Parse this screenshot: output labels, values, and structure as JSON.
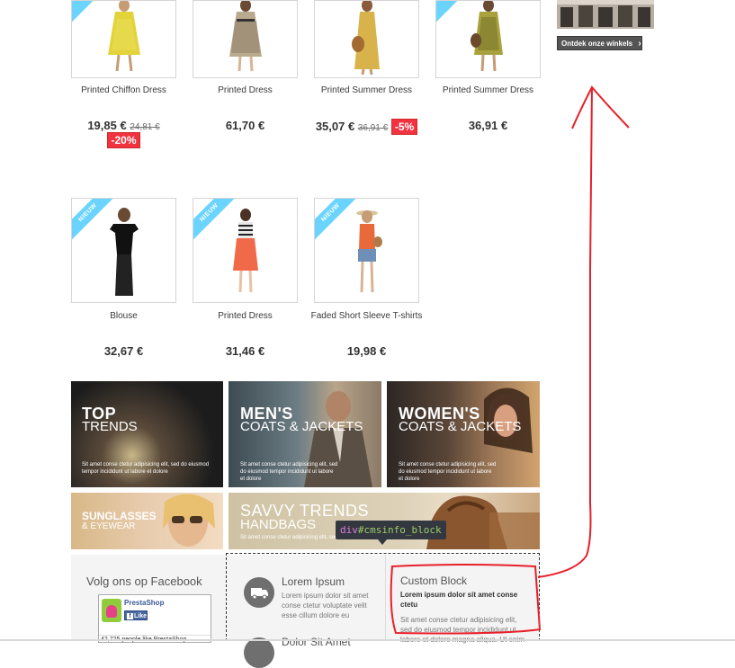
{
  "store": {
    "button_label": "Ontdek onze winkels",
    "chevron_glyph": "›"
  },
  "products_row1": [
    {
      "name": "Printed Chiffon Dress",
      "price": "19,85 €",
      "old_price": "24,81 €",
      "discount": "-20%"
    },
    {
      "name": "Printed Dress",
      "price": "61,70 €"
    },
    {
      "name": "Printed Summer Dress",
      "price": "35,07 €",
      "old_price": "36,91 €",
      "discount": "-5%"
    },
    {
      "name": "Printed Summer Dress",
      "price": "36,91 €"
    }
  ],
  "products_row2": [
    {
      "name": "Blouse",
      "price": "32,67 €",
      "badge": "NIEUW"
    },
    {
      "name": "Printed Dress",
      "price": "31,46 €",
      "badge": "NIEUW"
    },
    {
      "name": "Faded Short Sleeve T-shirts",
      "price": "19,98 €",
      "badge": "NIEUW"
    }
  ],
  "banners": {
    "top": {
      "line1": "TOP",
      "line2": "TRENDS",
      "text": "Sit amet conse ctetur adipisicing elit, sed do eiusmod tempor incididunt ut labore et dolore"
    },
    "men": {
      "line1": "MEN'S",
      "line2": "COATS & JACKETS",
      "text": "Sit amet conse ctetur adipisicing elit, sed do eiusmod tempor incididunt ut labore et dolore"
    },
    "women": {
      "line1": "WOMEN'S",
      "line2": "COATS & JACKETS",
      "text": "Sit amet conse ctetur adipisicing elit, sed do eiusmod tempor incididunt ut labore et dolore"
    },
    "sunglasses": {
      "line1": "SUNGLASSES",
      "line2": "& EYEWEAR"
    },
    "savvy": {
      "line1": "SAVVY TRENDS",
      "line2": "HANDBAGS",
      "text": "Sit amet conse ctetur adipisicing elit, sed do eiusmod"
    }
  },
  "tooltip": {
    "tag": "div",
    "id": "#cmsinfo_block"
  },
  "facebook": {
    "title": "Volg ons op Facebook",
    "brand": "PrestaShop",
    "like": "Like",
    "count": "42,725 people like PrestaShop"
  },
  "cms": {
    "title": "Lorem Ipsum",
    "text": "Lorem ipsum dolor sit amet conse ctetur voluptate velit esse cillum dolore eu",
    "title2": "Dolor Sit Amet"
  },
  "custom_block": {
    "title": "Custom Block",
    "subtitle": "Lorem ipsum dolor sit amet conse ctetu",
    "text": "Sit amet conse ctetur adipisicing elit, sed do eiusmod tempor incididunt ut labore et dolore magna aliqua. Ut enim"
  },
  "colors": {
    "annotation": "#e8202a",
    "badge": "#6ad4ff",
    "discount": "#f13340"
  }
}
